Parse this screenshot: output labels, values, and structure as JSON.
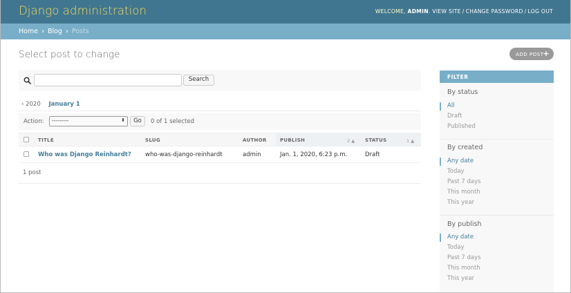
{
  "header": {
    "branding": "Django administration",
    "welcome": "WELCOME,",
    "username": "ADMIN",
    "links": [
      "VIEW SITE",
      "CHANGE PASSWORD",
      "LOG OUT"
    ],
    "separator": "/"
  },
  "breadcrumbs": {
    "items": [
      "Home",
      "Blog",
      "Posts"
    ],
    "separator": "›"
  },
  "page": {
    "title": "Select post to change",
    "add_button": "ADD POST",
    "add_icon": "+"
  },
  "search": {
    "value": "",
    "placeholder": "",
    "button": "Search",
    "icon": "search-icon"
  },
  "date_hierarchy": {
    "back": "‹ 2020",
    "current": "January 1"
  },
  "actions": {
    "label": "Action:",
    "selected_option": "---------",
    "go_button": "Go",
    "counter": "0 of 1 selected"
  },
  "table": {
    "columns": [
      {
        "label": "TITLE"
      },
      {
        "label": "SLUG"
      },
      {
        "label": "AUTHOR"
      },
      {
        "label": "PUBLISH",
        "sort_priority": "2",
        "sort_arrow": "▲"
      },
      {
        "label": "STATUS",
        "sort_priority": "1",
        "sort_arrow": "▲"
      }
    ],
    "rows": [
      {
        "title": "Who was Django Reinhardt?",
        "slug": "who-was-django-reinhardt",
        "author": "admin",
        "publish": "Jan. 1, 2020, 6:23 p.m.",
        "status": "Draft"
      }
    ]
  },
  "paginator": "1 post",
  "filter": {
    "heading": "FILTER",
    "groups": [
      {
        "title": "By status",
        "options": [
          "All",
          "Draft",
          "Published"
        ],
        "selected": 0
      },
      {
        "title": "By created",
        "options": [
          "Any date",
          "Today",
          "Past 7 days",
          "This month",
          "This year"
        ],
        "selected": 0
      },
      {
        "title": "By publish",
        "options": [
          "Any date",
          "Today",
          "Past 7 days",
          "This month",
          "This year"
        ],
        "selected": 0
      }
    ]
  },
  "colors": {
    "header_bg": "#417690",
    "branding": "#f5dd5d",
    "breadcrumb_bg": "#79aec8",
    "link": "#447e9b",
    "add_button_bg": "#999999"
  }
}
